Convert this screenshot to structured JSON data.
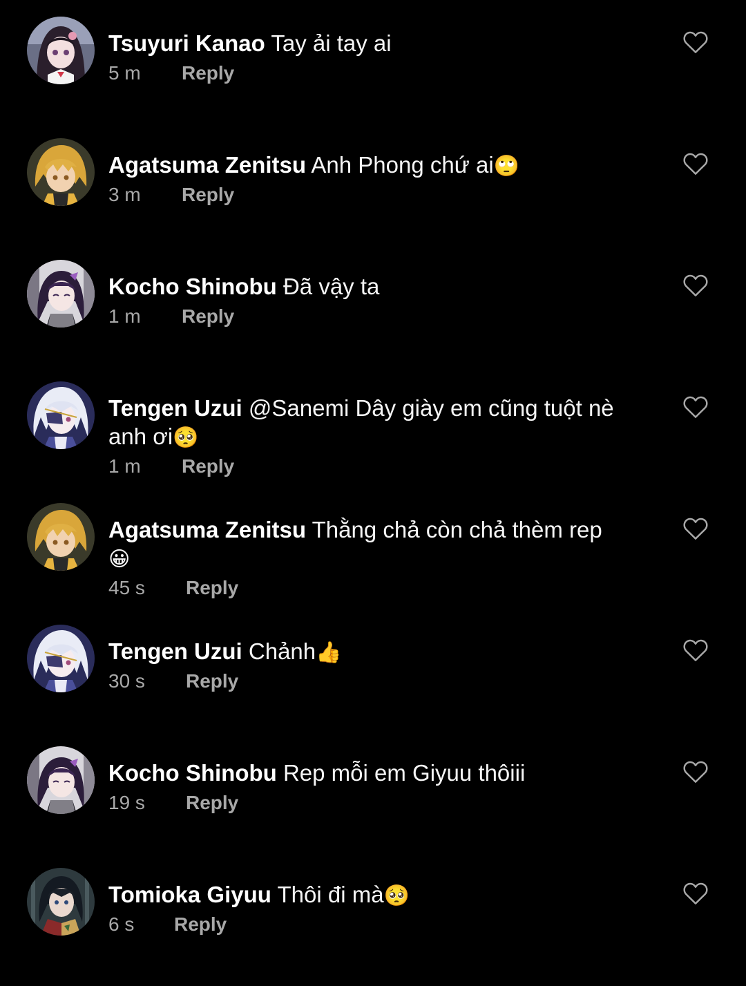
{
  "comments": [
    {
      "author": "Tsuyuri Kanao",
      "text": "Tay ải tay ai",
      "emoji": "",
      "time": "5 m",
      "reply": "Reply",
      "avatar": "kanao"
    },
    {
      "author": "Agatsuma Zenitsu",
      "text": "Anh Phong chứ ai",
      "emoji": "🙄",
      "time": "3 m",
      "reply": "Reply",
      "avatar": "zenitsu"
    },
    {
      "author": "Kocho Shinobu",
      "text": "Đã vậy ta",
      "emoji": "",
      "time": "1 m",
      "reply": "Reply",
      "avatar": "shinobu"
    },
    {
      "author": "Tengen Uzui",
      "text": "@Sanemi Dây giày em cũng tuột nè anh ơi",
      "emoji": "🥺",
      "time": "1 m",
      "reply": "Reply",
      "avatar": "tengen"
    },
    {
      "author": "Agatsuma Zenitsu",
      "text": "Thằng chả còn chả thèm rep",
      "emoji": "😀",
      "time": "45 s",
      "reply": "Reply",
      "avatar": "zenitsu"
    },
    {
      "author": "Tengen Uzui",
      "text": "Chảnh",
      "emoji": "👍",
      "time": "30 s",
      "reply": "Reply",
      "avatar": "tengen"
    },
    {
      "author": "Kocho Shinobu",
      "text": "Rep mỗi em Giyuu thôiii",
      "emoji": "",
      "time": "19 s",
      "reply": "Reply",
      "avatar": "shinobu"
    },
    {
      "author": "Tomioka Giyuu",
      "text": "Thôi đi mà",
      "emoji": "🥺",
      "time": "6 s",
      "reply": "Reply",
      "avatar": "giyuu"
    }
  ],
  "colors": {
    "background": "#000000",
    "text": "#f5f5f5",
    "secondary": "#a8a8a8",
    "like_icon": "#a8a8a8"
  },
  "icons": {
    "like": "heart-outline-icon"
  }
}
